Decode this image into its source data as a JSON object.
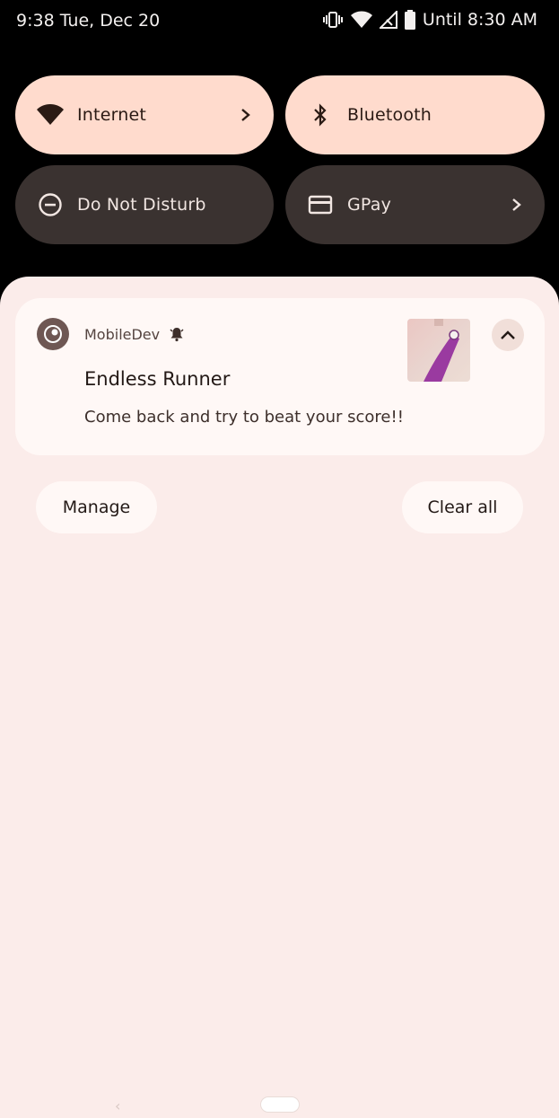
{
  "status_bar": {
    "time_date": "9:38 Tue, Dec 20",
    "alarm_text": "Until 8:30 AM"
  },
  "quick_settings": [
    {
      "label": "Internet",
      "state": "on",
      "icon": "wifi-icon",
      "has_chevron": true
    },
    {
      "label": "Bluetooth",
      "state": "on",
      "icon": "bluetooth-icon",
      "has_chevron": false
    },
    {
      "label": "Do Not Disturb",
      "state": "off",
      "icon": "do-not-disturb-icon",
      "has_chevron": false
    },
    {
      "label": "GPay",
      "state": "off",
      "icon": "card-icon",
      "has_chevron": true
    }
  ],
  "notification": {
    "app_name": "MobileDev",
    "title": "Endless Runner",
    "body": "Come back and try to beat your score!!"
  },
  "actions": {
    "manage": "Manage",
    "clear_all": "Clear all"
  },
  "colors": {
    "tile_on": "#ffdbcd",
    "tile_off": "#3a3230",
    "shade_bg": "#fbecea",
    "card_bg": "#fff8f6"
  }
}
